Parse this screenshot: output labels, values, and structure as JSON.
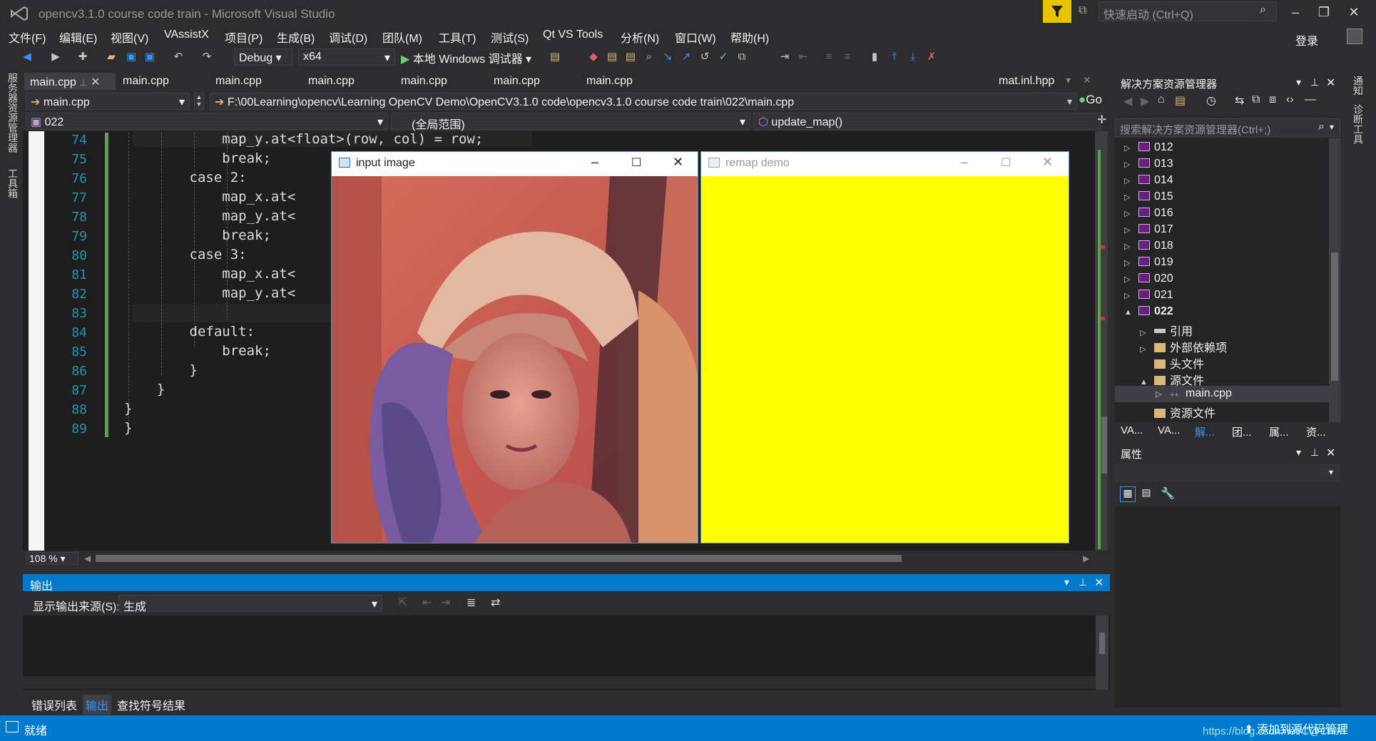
{
  "window": {
    "title": "opencv3.1.0  course code train - Microsoft Visual Studio",
    "quick_launch": "快速启动 (Ctrl+Q)",
    "sign_in": "登录"
  },
  "menu": [
    "文件(F)",
    "编辑(E)",
    "视图(V)",
    "VAssistX",
    "项目(P)",
    "生成(B)",
    "调试(D)",
    "团队(M)",
    "工具(T)",
    "测试(S)",
    "Qt VS Tools",
    "分析(N)",
    "窗口(W)",
    "帮助(H)"
  ],
  "toolbar": {
    "config": "Debug",
    "platform": "x64",
    "run_label": "本地 Windows 调试器"
  },
  "left_strip": [
    "服务器资源管理器",
    "工具箱"
  ],
  "right_strip": [
    "通知",
    "诊断工具"
  ],
  "editor_tabs": [
    "main.cpp",
    "main.cpp",
    "main.cpp",
    "main.cpp",
    "main.cpp",
    "main.cpp",
    "main.cpp",
    "mat.inl.hpp"
  ],
  "nav": {
    "file": "main.cpp",
    "path": "F:\\00Learning\\opencv\\Learning OpenCV Demo\\OpenCV3.1.0  code\\opencv3.1.0  course code train\\022\\main.cpp",
    "go": "Go",
    "project": "022",
    "scope": "(全局范围)",
    "function": "update_map()"
  },
  "code_lines": [
    {
      "n": "74",
      "text": "            map_y.at<float>(row, col) = row;"
    },
    {
      "n": "75",
      "text": "            break;"
    },
    {
      "n": "76",
      "text": "        case 2:"
    },
    {
      "n": "77",
      "text": "            map_x.at<"
    },
    {
      "n": "78",
      "text": "            map_y.at<"
    },
    {
      "n": "79",
      "text": "            break;"
    },
    {
      "n": "80",
      "text": "        case 3:"
    },
    {
      "n": "81",
      "text": "            map_x.at<"
    },
    {
      "n": "82",
      "text": "            map_y.at<"
    },
    {
      "n": "83",
      "text": ""
    },
    {
      "n": "84",
      "text": "        default:"
    },
    {
      "n": "85",
      "text": "            break;"
    },
    {
      "n": "86",
      "text": "        }"
    },
    {
      "n": "87",
      "text": "    }"
    },
    {
      "n": "88",
      "text": "}"
    },
    {
      "n": "89",
      "text": "}"
    }
  ],
  "zoom": "108 %",
  "popups": {
    "input_title": "input image",
    "remap_title": "remap demo",
    "remap_fill": "#ffff00"
  },
  "output": {
    "title": "输出",
    "source_label": "显示输出来源(S):",
    "source_value": "生成",
    "tabs": [
      "错误列表",
      "输出",
      "查找符号结果"
    ]
  },
  "solution_explorer": {
    "title": "解决方案资源管理器",
    "search": "搜索解决方案资源管理器(Ctrl+;)",
    "projects": [
      "012",
      "013",
      "014",
      "015",
      "016",
      "017",
      "018",
      "019",
      "020",
      "021",
      "022"
    ],
    "children": [
      "引用",
      "外部依赖项",
      "头文件",
      "源文件",
      "main.cpp",
      "资源文件"
    ],
    "bottom_tabs": [
      "VA...",
      "VA...",
      "解...",
      "团...",
      "属...",
      "资..."
    ]
  },
  "properties": {
    "title": "属性"
  },
  "status": {
    "text": "就绪",
    "source_control": "添加到源代码管理",
    "watermark": "https://blog.csdn.net/C@Chen"
  }
}
